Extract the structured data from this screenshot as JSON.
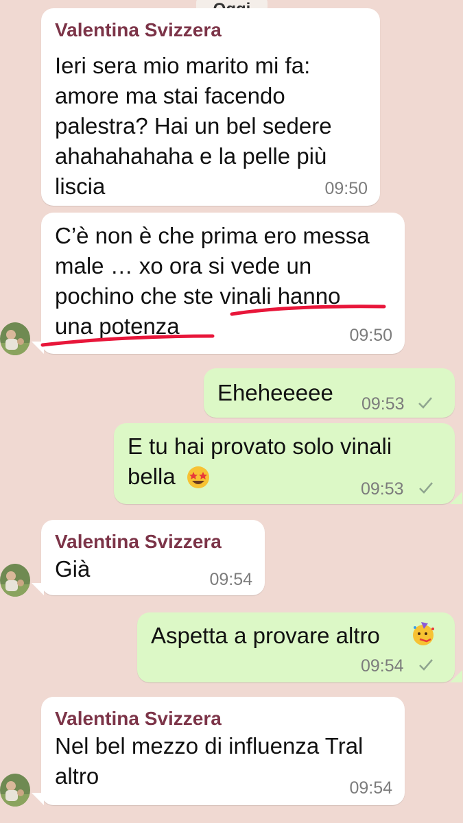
{
  "date_label": "Oggi",
  "colors": {
    "background": "#f0d9d2",
    "incoming_bubble": "#ffffff",
    "outgoing_bubble": "#dcf8c6",
    "sender_name": "#7c3448",
    "underline_annotation": "#e8163a",
    "tick": "#8fa58f"
  },
  "messages": [
    {
      "direction": "incoming",
      "sender": "Valentina Svizzera",
      "lines": [
        "Ieri sera mio marito mi fa:",
        "amore ma stai facendo",
        "palestra? Hai un bel sedere",
        "ahahahahaha e la pelle più",
        "liscia"
      ],
      "time": "09:50"
    },
    {
      "direction": "incoming",
      "lines": [
        "C’è non è che prima ero messa",
        "male … xo ora si vede un",
        "pochino che ste vinali hanno",
        "una potenza"
      ],
      "time": "09:50",
      "annotation": "red hand-drawn underline under 'vinali hanno una potenza'"
    },
    {
      "direction": "outgoing",
      "lines": [
        "Eheheeeee"
      ],
      "time": "09:53",
      "status": "sent-tick"
    },
    {
      "direction": "outgoing",
      "lines": [
        "E tu hai provato solo vinali",
        "bella"
      ],
      "emoji": "star-struck",
      "time": "09:53",
      "status": "sent-tick"
    },
    {
      "direction": "incoming",
      "sender": "Valentina Svizzera",
      "lines": [
        "Già"
      ],
      "time": "09:54"
    },
    {
      "direction": "outgoing",
      "lines": [
        "Aspetta a provare altro"
      ],
      "emoji": "partying-face",
      "time": "09:54",
      "status": "sent-tick"
    },
    {
      "direction": "incoming",
      "sender": "Valentina Svizzera",
      "lines": [
        "Nel bel mezzo di influenza Tral",
        "altro"
      ],
      "time": "09:54"
    }
  ]
}
